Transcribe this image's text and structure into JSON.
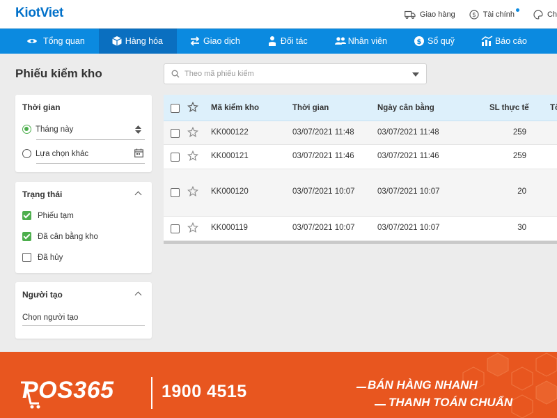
{
  "app": {
    "logo": "KiotViet"
  },
  "top_links": [
    {
      "label": "Giao hàng",
      "icon": "truck-icon"
    },
    {
      "label": "Tài chính",
      "icon": "dollar-icon",
      "has_dot": true
    },
    {
      "label": "Ch",
      "icon": "palette-icon"
    }
  ],
  "nav": [
    {
      "label": "Tổng quan",
      "icon": "eye-icon",
      "active": false
    },
    {
      "label": "Hàng hóa",
      "icon": "box-icon",
      "active": true
    },
    {
      "label": "Giao dịch",
      "icon": "exchange-icon",
      "active": false
    },
    {
      "label": "Đối tác",
      "icon": "user-icon",
      "active": false
    },
    {
      "label": "Nhân viên",
      "icon": "users-icon",
      "active": false
    },
    {
      "label": "Sổ quỹ",
      "icon": "dollar-circle-icon",
      "active": false
    },
    {
      "label": "Báo cáo",
      "icon": "chart-icon",
      "active": false
    }
  ],
  "page": {
    "title": "Phiếu kiểm kho"
  },
  "search": {
    "placeholder": "Theo mã phiếu kiểm"
  },
  "filters": {
    "time": {
      "title": "Thời gian",
      "option_this_month": "Tháng này",
      "option_custom": "Lựa chọn khác",
      "selected": "this_month"
    },
    "status": {
      "title": "Trạng thái",
      "options": [
        {
          "label": "Phiếu tạm",
          "checked": true
        },
        {
          "label": "Đã cân bằng kho",
          "checked": true
        },
        {
          "label": "Đã hủy",
          "checked": false
        }
      ]
    },
    "creator": {
      "title": "Người tạo",
      "placeholder": "Chọn người tạo"
    }
  },
  "table": {
    "columns": [
      "Mã kiểm kho",
      "Thời gian",
      "Ngày cân bằng",
      "SL thực tế",
      "Tổ"
    ],
    "rows": [
      {
        "code": "KK000122",
        "time": "03/07/2021 11:48",
        "balance_date": "03/07/2021 11:48",
        "qty": "259"
      },
      {
        "code": "KK000121",
        "time": "03/07/2021 11:46",
        "balance_date": "03/07/2021 11:46",
        "qty": "259"
      },
      {
        "code": "KK000120",
        "time": "03/07/2021 10:07",
        "balance_date": "03/07/2021 10:07",
        "qty": "20"
      },
      {
        "code": "KK000119",
        "time": "03/07/2021 10:07",
        "balance_date": "03/07/2021 10:07",
        "qty": "30"
      }
    ]
  },
  "banner": {
    "brand": "POS365",
    "phone": "1900 4515",
    "tagline_1": "BÁN HÀNG NHANH",
    "tagline_2": "THANH TOÁN CHUẨN",
    "color": "#e8561f"
  },
  "colors": {
    "nav": "#0b8ae0",
    "nav_active": "#0a6fc0",
    "accent_green": "#4cae4c",
    "table_header": "#ddf0fb"
  }
}
